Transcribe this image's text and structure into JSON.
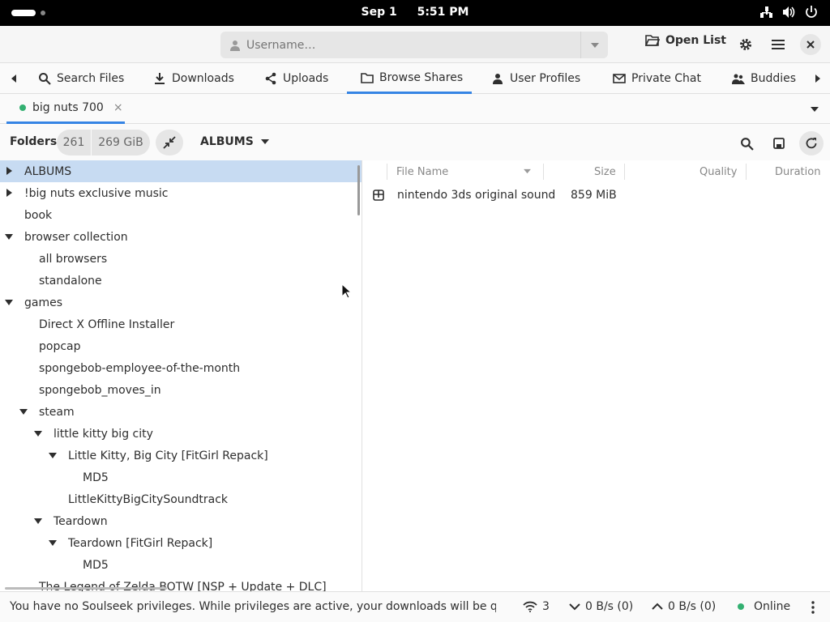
{
  "system_bar": {
    "date": "Sep 1",
    "time": "5:51 PM",
    "tray_icons": [
      "network-icon",
      "volume-icon",
      "power-icon"
    ]
  },
  "header": {
    "username_placeholder": "Username…",
    "open_list_label": "Open List",
    "buttons": [
      "gear-icon",
      "menu-icon",
      "close-icon"
    ]
  },
  "tabs": [
    {
      "label": "Search Files",
      "icon": "search-icon"
    },
    {
      "label": "Downloads",
      "icon": "download-icon"
    },
    {
      "label": "Uploads",
      "icon": "share-icon"
    },
    {
      "label": "Browse Shares",
      "icon": "folder-icon",
      "active": true
    },
    {
      "label": "User Profiles",
      "icon": "user-icon"
    },
    {
      "label": "Private Chat",
      "icon": "mail-icon"
    },
    {
      "label": "Buddies",
      "icon": "buddies-icon"
    }
  ],
  "subtab": {
    "label": "big nuts 700",
    "close": "×",
    "status_color": "#33b071"
  },
  "toolbar": {
    "folders_label": "Folders",
    "folder_count": "261",
    "total_size": "269 GiB",
    "current_folder": "ALBUMS"
  },
  "folder_tree": [
    {
      "label": "ALBUMS",
      "level": 0,
      "expander": "collapsed",
      "selected": true
    },
    {
      "label": "!big nuts exclusive music",
      "level": 0,
      "expander": "collapsed"
    },
    {
      "label": "book",
      "level": 0,
      "expander": "none"
    },
    {
      "label": "browser collection",
      "level": 0,
      "expander": "expanded"
    },
    {
      "label": "all browsers",
      "level": 1,
      "expander": "none"
    },
    {
      "label": "standalone",
      "level": 1,
      "expander": "none"
    },
    {
      "label": "games",
      "level": 0,
      "expander": "expanded"
    },
    {
      "label": "Direct X Offline Installer",
      "level": 1,
      "expander": "none"
    },
    {
      "label": "popcap",
      "level": 1,
      "expander": "none"
    },
    {
      "label": "spongebob-employee-of-the-month",
      "level": 1,
      "expander": "none"
    },
    {
      "label": "spongebob_moves_in",
      "level": 1,
      "expander": "none"
    },
    {
      "label": "steam",
      "level": 1,
      "expander": "expanded"
    },
    {
      "label": "little kitty big city",
      "level": 2,
      "expander": "expanded"
    },
    {
      "label": "Little Kitty, Big City [FitGirl Repack]",
      "level": 3,
      "expander": "expanded"
    },
    {
      "label": "MD5",
      "level": 4,
      "expander": "none"
    },
    {
      "label": "LittleKittyBigCitySoundtrack",
      "level": 3,
      "expander": "none"
    },
    {
      "label": "Teardown",
      "level": 2,
      "expander": "expanded"
    },
    {
      "label": "Teardown [FitGirl Repack]",
      "level": 3,
      "expander": "expanded"
    },
    {
      "label": "MD5",
      "level": 4,
      "expander": "none"
    },
    {
      "label": "The Legend of Zelda BOTW [NSP + Update + DLC]",
      "level": 1,
      "expander": "none"
    }
  ],
  "file_columns": {
    "name": "File Name",
    "size": "Size",
    "quality": "Quality",
    "duration": "Duration"
  },
  "files": [
    {
      "name": "nintendo 3ds original sound",
      "size": "859 MiB",
      "icon": "archive-icon"
    }
  ],
  "status_bar": {
    "message": "You have no Soulseek privileges. While privileges are active, your downloads will be queue…",
    "connections": "3",
    "download_speed": "0 B/s (0)",
    "upload_speed": "0 B/s (0)",
    "online_status": "Online"
  }
}
